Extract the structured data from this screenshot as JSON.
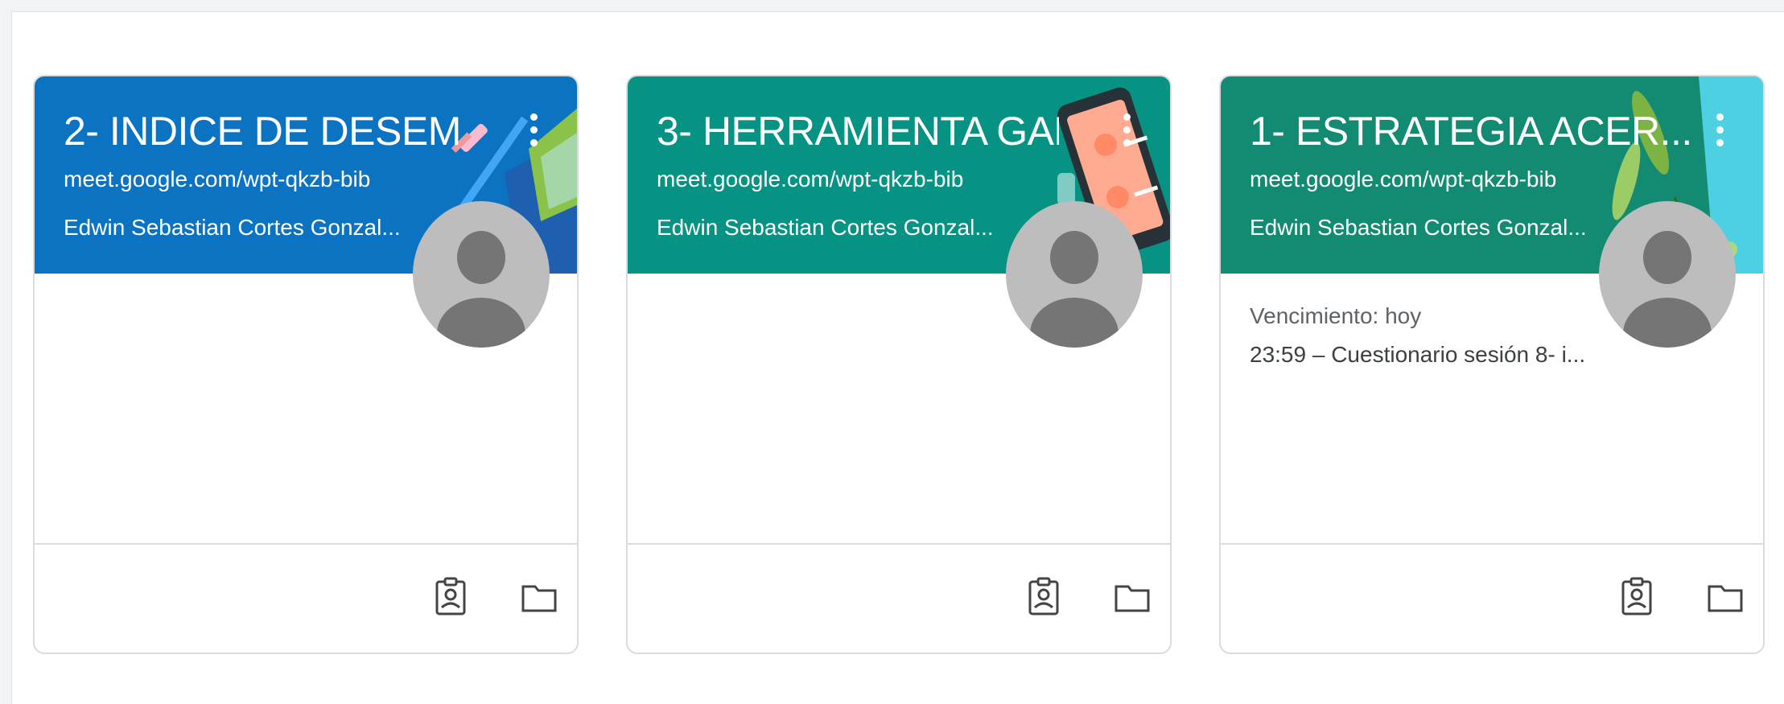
{
  "cards": [
    {
      "title": "2- INDICE DE DESEM",
      "section": "meet.google.com/wpt-qkzb-bib",
      "teacher": "Edwin Sebastian Cortes Gonzal...",
      "header_color": "#0b73c2",
      "due_label": "",
      "due_item": ""
    },
    {
      "title": "3- HERRAMIENTA GAE",
      "section": "meet.google.com/wpt-qkzb-bib",
      "teacher": "Edwin Sebastian Cortes Gonzal...",
      "header_color": "#079384",
      "due_label": "",
      "due_item": ""
    },
    {
      "title": "1- ESTRATEGIA ACER...",
      "section": "meet.google.com/wpt-qkzb-bib",
      "teacher": "Edwin Sebastian Cortes Gonzal...",
      "header_color": "#138a72",
      "due_label": "Vencimiento: hoy",
      "due_item": "23:59 – Cuestionario sesión 8- i..."
    }
  ],
  "icons": {
    "more": "more-vert-icon",
    "portfolio": "assignment-ind-icon",
    "folder": "folder-icon",
    "avatar": "account-circle-icon"
  }
}
